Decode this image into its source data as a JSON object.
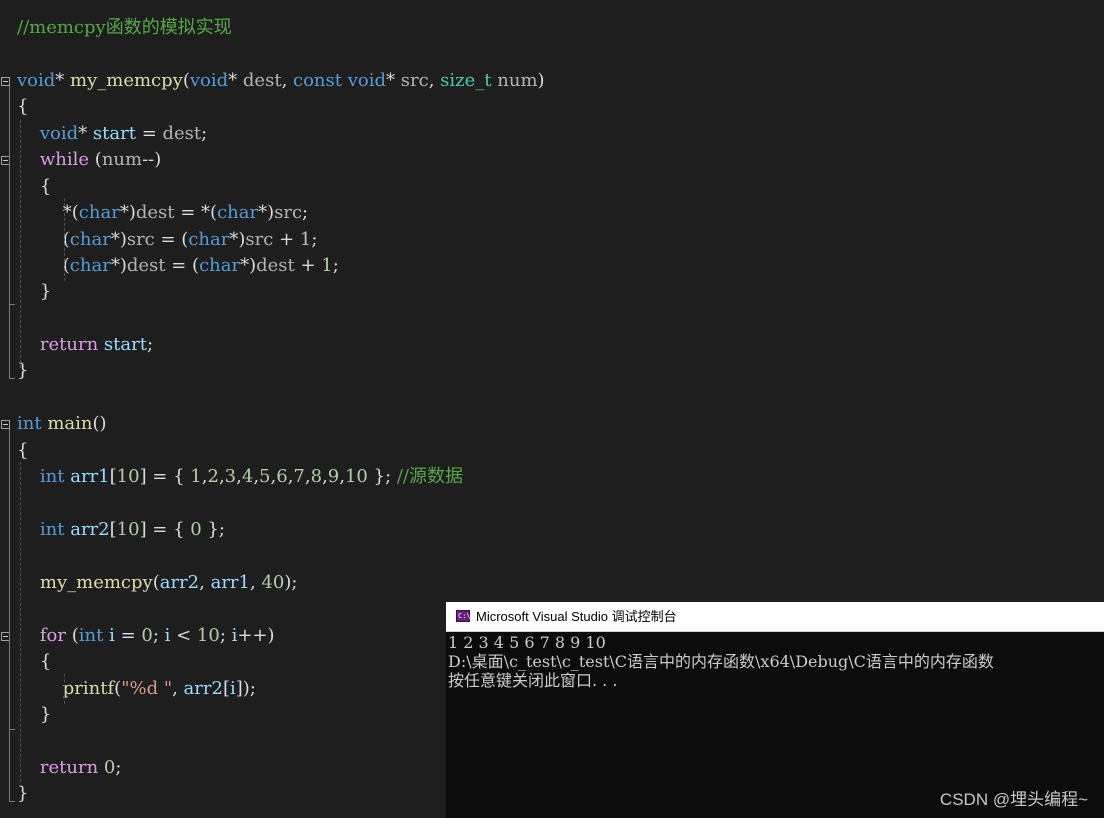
{
  "editor": {
    "lines": [
      {
        "tokens": [
          {
            "t": "//memcpy函数的模拟实现",
            "c": "cmt"
          }
        ]
      },
      {
        "tokens": [
          {
            "t": "void",
            "c": "kw"
          },
          {
            "t": "* ",
            "c": "par"
          },
          {
            "t": "my_memcpy",
            "c": "fn"
          },
          {
            "t": "(",
            "c": "par"
          },
          {
            "t": "void",
            "c": "kw"
          },
          {
            "t": "* ",
            "c": "par"
          },
          {
            "t": "dest",
            "c": "punc"
          },
          {
            "t": ", ",
            "c": "par"
          },
          {
            "t": "const",
            "c": "kw"
          },
          {
            "t": " ",
            "c": "par"
          },
          {
            "t": "void",
            "c": "kw"
          },
          {
            "t": "* ",
            "c": "par"
          },
          {
            "t": "src",
            "c": "punc"
          },
          {
            "t": ", ",
            "c": "par"
          },
          {
            "t": "size_t",
            "c": "type"
          },
          {
            "t": " ",
            "c": "par"
          },
          {
            "t": "num",
            "c": "punc"
          },
          {
            "t": ")",
            "c": "par"
          }
        ]
      },
      {
        "tokens": [
          {
            "t": "{",
            "c": "par"
          }
        ]
      },
      {
        "tokens": [
          {
            "t": "    ",
            "c": "par"
          },
          {
            "t": "void",
            "c": "kw"
          },
          {
            "t": "* ",
            "c": "par"
          },
          {
            "t": "start",
            "c": "var"
          },
          {
            "t": " = ",
            "c": "par"
          },
          {
            "t": "dest",
            "c": "punc"
          },
          {
            "t": ";",
            "c": "par"
          }
        ]
      },
      {
        "tokens": [
          {
            "t": "    ",
            "c": "par"
          },
          {
            "t": "while",
            "c": "ctl"
          },
          {
            "t": " (",
            "c": "par"
          },
          {
            "t": "num",
            "c": "punc"
          },
          {
            "t": "--)",
            "c": "par"
          }
        ]
      },
      {
        "tokens": [
          {
            "t": "    {",
            "c": "par"
          }
        ]
      },
      {
        "tokens": [
          {
            "t": "        *(",
            "c": "par"
          },
          {
            "t": "char",
            "c": "kw"
          },
          {
            "t": "*)",
            "c": "par"
          },
          {
            "t": "dest",
            "c": "punc"
          },
          {
            "t": " = *(",
            "c": "par"
          },
          {
            "t": "char",
            "c": "kw"
          },
          {
            "t": "*)",
            "c": "par"
          },
          {
            "t": "src",
            "c": "punc"
          },
          {
            "t": ";",
            "c": "par"
          }
        ]
      },
      {
        "tokens": [
          {
            "t": "        (",
            "c": "par"
          },
          {
            "t": "char",
            "c": "kw"
          },
          {
            "t": "*)",
            "c": "par"
          },
          {
            "t": "src",
            "c": "punc"
          },
          {
            "t": " = (",
            "c": "par"
          },
          {
            "t": "char",
            "c": "kw"
          },
          {
            "t": "*)",
            "c": "par"
          },
          {
            "t": "src",
            "c": "punc"
          },
          {
            "t": " + ",
            "c": "par"
          },
          {
            "t": "1",
            "c": "num"
          },
          {
            "t": ";",
            "c": "par"
          }
        ]
      },
      {
        "tokens": [
          {
            "t": "        (",
            "c": "par"
          },
          {
            "t": "char",
            "c": "kw"
          },
          {
            "t": "*)",
            "c": "par"
          },
          {
            "t": "dest",
            "c": "punc"
          },
          {
            "t": " = (",
            "c": "par"
          },
          {
            "t": "char",
            "c": "kw"
          },
          {
            "t": "*)",
            "c": "par"
          },
          {
            "t": "dest",
            "c": "punc"
          },
          {
            "t": " + ",
            "c": "par"
          },
          {
            "t": "1",
            "c": "num"
          },
          {
            "t": ";",
            "c": "par"
          }
        ]
      },
      {
        "tokens": [
          {
            "t": "    }",
            "c": "par"
          }
        ]
      },
      {
        "tokens": [
          {
            "t": "    ",
            "c": "par"
          },
          {
            "t": "return",
            "c": "ctl"
          },
          {
            "t": " ",
            "c": "par"
          },
          {
            "t": "start",
            "c": "var"
          },
          {
            "t": ";",
            "c": "par"
          }
        ]
      },
      {
        "tokens": [
          {
            "t": "}",
            "c": "par"
          }
        ]
      },
      {
        "tokens": [
          {
            "t": "int",
            "c": "kw"
          },
          {
            "t": " ",
            "c": "par"
          },
          {
            "t": "main",
            "c": "fn"
          },
          {
            "t": "()",
            "c": "par"
          }
        ]
      },
      {
        "tokens": [
          {
            "t": "{",
            "c": "par"
          }
        ]
      },
      {
        "tokens": [
          {
            "t": "    ",
            "c": "par"
          },
          {
            "t": "int",
            "c": "kw"
          },
          {
            "t": " ",
            "c": "par"
          },
          {
            "t": "arr1",
            "c": "var"
          },
          {
            "t": "[",
            "c": "par"
          },
          {
            "t": "10",
            "c": "num"
          },
          {
            "t": "] = { ",
            "c": "par"
          },
          {
            "t": "1",
            "c": "num"
          },
          {
            "t": ",",
            "c": "par"
          },
          {
            "t": "2",
            "c": "num"
          },
          {
            "t": ",",
            "c": "par"
          },
          {
            "t": "3",
            "c": "num"
          },
          {
            "t": ",",
            "c": "par"
          },
          {
            "t": "4",
            "c": "num"
          },
          {
            "t": ",",
            "c": "par"
          },
          {
            "t": "5",
            "c": "num"
          },
          {
            "t": ",",
            "c": "par"
          },
          {
            "t": "6",
            "c": "num"
          },
          {
            "t": ",",
            "c": "par"
          },
          {
            "t": "7",
            "c": "num"
          },
          {
            "t": ",",
            "c": "par"
          },
          {
            "t": "8",
            "c": "num"
          },
          {
            "t": ",",
            "c": "par"
          },
          {
            "t": "9",
            "c": "num"
          },
          {
            "t": ",",
            "c": "par"
          },
          {
            "t": "10",
            "c": "num"
          },
          {
            "t": " }; ",
            "c": "par"
          },
          {
            "t": "//源数据",
            "c": "cmt"
          }
        ]
      },
      {
        "tokens": [
          {
            "t": "    ",
            "c": "par"
          },
          {
            "t": "int",
            "c": "kw"
          },
          {
            "t": " ",
            "c": "par"
          },
          {
            "t": "arr2",
            "c": "var"
          },
          {
            "t": "[",
            "c": "par"
          },
          {
            "t": "10",
            "c": "num"
          },
          {
            "t": "] = { ",
            "c": "par"
          },
          {
            "t": "0",
            "c": "num"
          },
          {
            "t": " };",
            "c": "par"
          }
        ]
      },
      {
        "tokens": [
          {
            "t": "    ",
            "c": "par"
          },
          {
            "t": "my_memcpy",
            "c": "fn"
          },
          {
            "t": "(",
            "c": "par"
          },
          {
            "t": "arr2",
            "c": "var"
          },
          {
            "t": ", ",
            "c": "par"
          },
          {
            "t": "arr1",
            "c": "var"
          },
          {
            "t": ", ",
            "c": "par"
          },
          {
            "t": "40",
            "c": "num"
          },
          {
            "t": ");",
            "c": "par"
          }
        ]
      },
      {
        "tokens": [
          {
            "t": "    ",
            "c": "par"
          },
          {
            "t": "for",
            "c": "ctl"
          },
          {
            "t": " (",
            "c": "par"
          },
          {
            "t": "int",
            "c": "kw"
          },
          {
            "t": " ",
            "c": "par"
          },
          {
            "t": "i",
            "c": "var"
          },
          {
            "t": " = ",
            "c": "par"
          },
          {
            "t": "0",
            "c": "num"
          },
          {
            "t": "; ",
            "c": "par"
          },
          {
            "t": "i",
            "c": "var"
          },
          {
            "t": " < ",
            "c": "par"
          },
          {
            "t": "10",
            "c": "num"
          },
          {
            "t": "; ",
            "c": "par"
          },
          {
            "t": "i",
            "c": "var"
          },
          {
            "t": "++)",
            "c": "par"
          }
        ]
      },
      {
        "tokens": [
          {
            "t": "    {",
            "c": "par"
          }
        ]
      },
      {
        "tokens": [
          {
            "t": "        ",
            "c": "par"
          },
          {
            "t": "printf",
            "c": "fn"
          },
          {
            "t": "(",
            "c": "par"
          },
          {
            "t": "\"%d \"",
            "c": "str"
          },
          {
            "t": ", ",
            "c": "par"
          },
          {
            "t": "arr2",
            "c": "var"
          },
          {
            "t": "[",
            "c": "par"
          },
          {
            "t": "i",
            "c": "var"
          },
          {
            "t": "]);",
            "c": "par"
          }
        ]
      },
      {
        "tokens": [
          {
            "t": "    }",
            "c": "par"
          }
        ]
      },
      {
        "tokens": [
          {
            "t": "    ",
            "c": "par"
          },
          {
            "t": "return",
            "c": "ctl"
          },
          {
            "t": " ",
            "c": "par"
          },
          {
            "t": "0",
            "c": "num"
          },
          {
            "t": ";",
            "c": "par"
          }
        ]
      },
      {
        "tokens": [
          {
            "t": "}",
            "c": "par"
          }
        ]
      }
    ]
  },
  "console": {
    "title": "Microsoft Visual Studio 调试控制台",
    "output": [
      "1 2 3 4 5 6 7 8 9 10",
      "D:\\桌面\\c_test\\c_test\\C语言中的内存函数\\x64\\Debug\\C语言中的内存函数",
      "按任意键关闭此窗口. . ."
    ]
  },
  "watermark": "CSDN @埋头编程~",
  "colors": {
    "editor_bg": "#1e1e1e",
    "keyword": "#569cd6",
    "control": "#d8a0df",
    "function": "#dcdcaa",
    "variable": "#9cdcfe",
    "type": "#4ec9b0",
    "number": "#b5cea8",
    "string": "#d69d85",
    "comment": "#57a64a",
    "console_bg": "#0c0c0c"
  }
}
